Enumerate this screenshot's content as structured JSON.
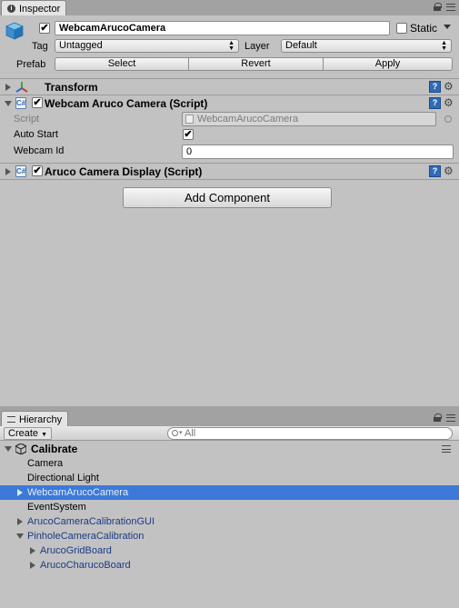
{
  "inspector": {
    "tab_label": "Inspector",
    "object_name": "WebcamArucoCamera",
    "static_label": "Static",
    "tag_label": "Tag",
    "tag_value": "Untagged",
    "layer_label": "Layer",
    "layer_value": "Default",
    "prefab_label": "Prefab",
    "prefab_buttons": {
      "select": "Select",
      "revert": "Revert",
      "apply": "Apply"
    },
    "components": {
      "transform": {
        "title": "Transform"
      },
      "webcam_script": {
        "title": "Webcam Aruco Camera (Script)",
        "script_label": "Script",
        "script_value": "WebcamArucoCamera",
        "auto_start_label": "Auto Start",
        "auto_start_checked": true,
        "webcam_id_label": "Webcam Id",
        "webcam_id_value": "0"
      },
      "display_script": {
        "title": "Aruco Camera Display (Script)"
      }
    },
    "add_component_label": "Add Component"
  },
  "hierarchy": {
    "tab_label": "Hierarchy",
    "create_label": "Create",
    "search_placeholder": "All",
    "scene_name": "Calibrate",
    "items": [
      {
        "label": "Camera"
      },
      {
        "label": "Directional Light"
      },
      {
        "label": "WebcamArucoCamera"
      },
      {
        "label": "EventSystem"
      },
      {
        "label": "ArucoCameraCalibrationGUI"
      },
      {
        "label": "PinholeCameraCalibration"
      },
      {
        "label": "ArucoGridBoard"
      },
      {
        "label": "ArucoCharucoBoard"
      }
    ]
  },
  "colors": {
    "selection": "#3c79d8",
    "prefab_text": "#1b3a86",
    "panel_bg": "#c2c2c2"
  }
}
